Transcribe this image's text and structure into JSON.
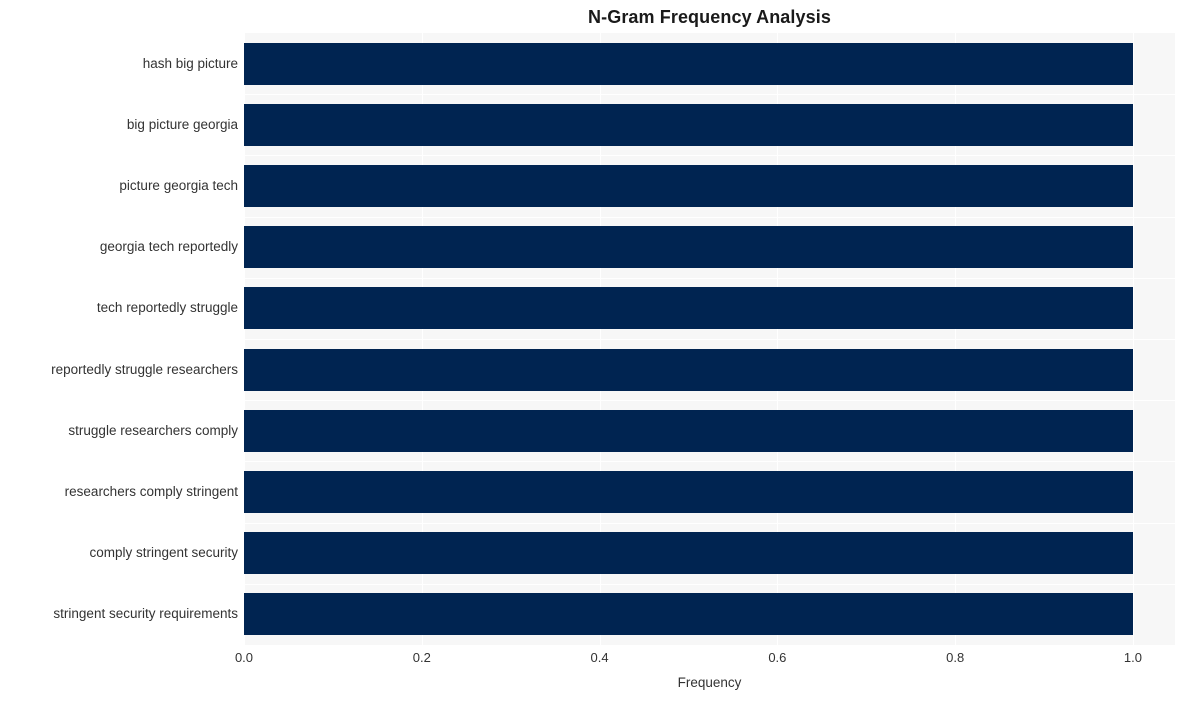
{
  "chart_data": {
    "type": "bar",
    "orientation": "horizontal",
    "title": "N-Gram Frequency Analysis",
    "xlabel": "Frequency",
    "ylabel": "",
    "categories": [
      "hash big picture",
      "big picture georgia",
      "picture georgia tech",
      "georgia tech reportedly",
      "tech reportedly struggle",
      "reportedly struggle researchers",
      "struggle researchers comply",
      "researchers comply stringent",
      "comply stringent security",
      "stringent security requirements"
    ],
    "values": [
      1.0,
      1.0,
      1.0,
      1.0,
      1.0,
      1.0,
      1.0,
      1.0,
      1.0,
      1.0
    ],
    "xticks": [
      "0.0",
      "0.2",
      "0.4",
      "0.6",
      "0.8",
      "1.0"
    ],
    "xtick_values": [
      0.0,
      0.2,
      0.4,
      0.6,
      0.8,
      1.0
    ],
    "xlim": [
      0.0,
      1.0473
    ],
    "grid": true,
    "legend": false,
    "bar_color": "#002451",
    "plot_background": "#f7f7f7",
    "grid_color": "#ffffff",
    "figure_background": "#ffffff",
    "text_color": "#333333",
    "title_color": "#1a1a1a"
  }
}
